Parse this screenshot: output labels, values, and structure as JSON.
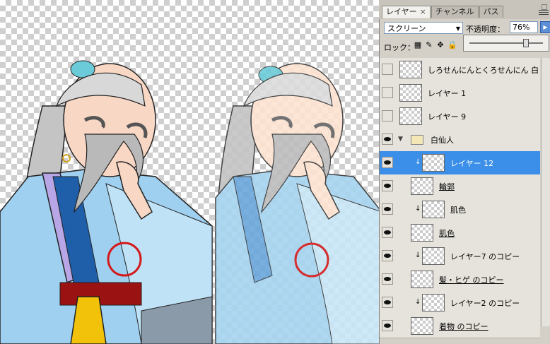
{
  "panel": {
    "tabs": [
      "レイヤー",
      "チャンネル",
      "パス"
    ],
    "tab_close": "×",
    "blend_mode": "スクリーン",
    "opacity_label": "不透明度：",
    "opacity_value": "76%",
    "opacity_slider_fraction": 0.76,
    "lock_label": "ロック："
  },
  "layers": [
    {
      "name": "しろせんにんとくろせんにん 白",
      "visible": false,
      "underline": false,
      "clip": false,
      "folder": false
    },
    {
      "name": "レイヤー 1",
      "visible": false,
      "underline": false,
      "clip": false,
      "folder": false
    },
    {
      "name": "レイヤー 9",
      "visible": false,
      "underline": false,
      "clip": false,
      "folder": false
    },
    {
      "name": "白仙人",
      "visible": true,
      "underline": false,
      "clip": false,
      "folder": true
    },
    {
      "name": "レイヤー 12",
      "visible": true,
      "underline": false,
      "clip": true,
      "folder": false,
      "selected": true
    },
    {
      "name": "輪郭",
      "visible": true,
      "underline": true,
      "clip": false,
      "folder": false
    },
    {
      "name": "肌色",
      "visible": true,
      "underline": false,
      "clip": true,
      "folder": false
    },
    {
      "name": "肌色",
      "visible": true,
      "underline": true,
      "clip": false,
      "folder": false
    },
    {
      "name": "レイヤー7 のコピー",
      "visible": true,
      "underline": false,
      "clip": true,
      "folder": false
    },
    {
      "name": "髪・ヒゲ のコピー",
      "visible": true,
      "underline": true,
      "clip": false,
      "folder": false
    },
    {
      "name": "レイヤー2 のコピー",
      "visible": true,
      "underline": false,
      "clip": true,
      "folder": false
    },
    {
      "name": "着物 のコピー",
      "visible": true,
      "underline": true,
      "clip": false,
      "folder": false
    }
  ],
  "colors": {
    "selection": "#3b8fe8",
    "highlight_circle": "#d41a1a",
    "robe_blue": "#8cc4e8",
    "robe_purple": "#b9a6e6",
    "sash_red": "#9b1212",
    "sash_yellow": "#f2c10a"
  },
  "icons": [
    "eye-icon",
    "folder-icon",
    "clip-arrow-icon",
    "lock-icons",
    "panel-menu-icon"
  ]
}
